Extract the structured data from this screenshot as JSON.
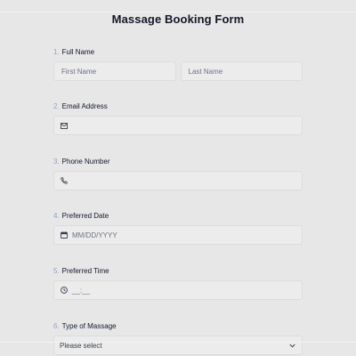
{
  "form": {
    "title": "Massage Booking Form",
    "fields": {
      "full_name": {
        "number": "1.",
        "label": "Full Name",
        "first_placeholder": "First Name",
        "last_placeholder": "Last Name"
      },
      "email": {
        "number": "2.",
        "label": "Email Address",
        "value": ""
      },
      "phone": {
        "number": "3.",
        "label": "Phone Number",
        "value": ""
      },
      "date": {
        "number": "4.",
        "label": "Preferred Date",
        "placeholder": "MM/DD/YYYY"
      },
      "time": {
        "number": "5.",
        "label": "Preferred Time",
        "placeholder": "__:__"
      },
      "massage_type": {
        "number": "6.",
        "label": "Type of Massage",
        "selected": "Please select"
      }
    }
  },
  "icons": {
    "email": "mail-icon",
    "phone": "phone-icon",
    "date": "calendar-icon",
    "time": "clock-icon",
    "select": "chevron-down-icon"
  },
  "colors": {
    "background": "#e7e7e7",
    "input_bg": "#ececec",
    "number_accent": "#8ea2c4"
  }
}
